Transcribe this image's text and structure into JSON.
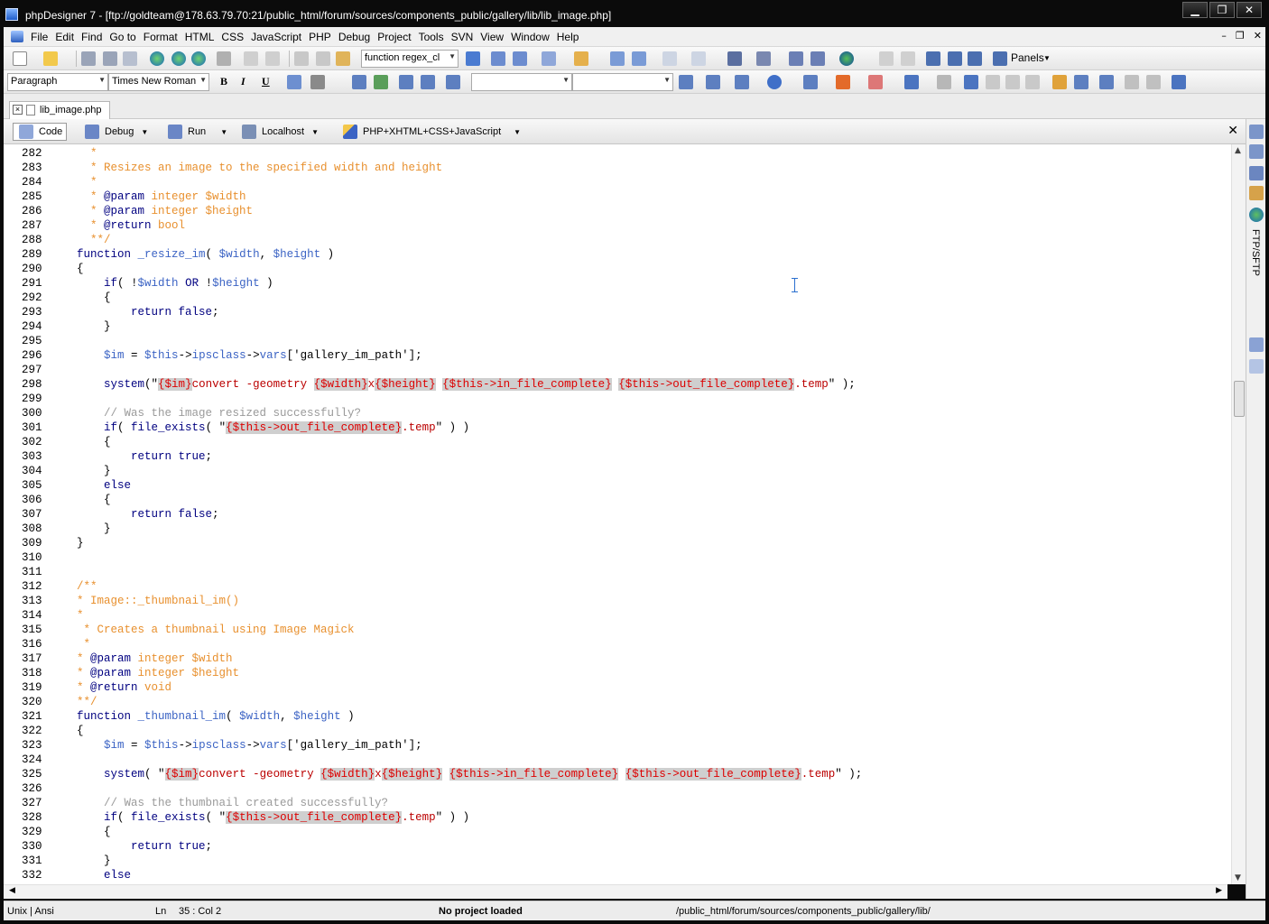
{
  "window": {
    "title": "phpDesigner 7 - [ftp://goldteam@178.63.79.70:21/public_html/forum/sources/components_public/gallery/lib/lib_image.php]",
    "minimize": "▁",
    "maximize": "❐",
    "close": "✕"
  },
  "menu": {
    "items": [
      "File",
      "Edit",
      "Find",
      "Go to",
      "Format",
      "HTML",
      "CSS",
      "JavaScript",
      "PHP",
      "Debug",
      "Project",
      "Tools",
      "SVN",
      "View",
      "Window",
      "Help"
    ],
    "mdi_minimize": "–",
    "mdi_restore": "❐",
    "mdi_close": "✕"
  },
  "toolbar1": {
    "function_combo": "function regex_cl",
    "panels_label": "Panels"
  },
  "toolbar2": {
    "paragraph_combo": "Paragraph",
    "font_combo": "Times New Roman",
    "bold": "B",
    "italic": "I",
    "underline": "U"
  },
  "tabs": {
    "file_tab": "lib_image.php",
    "close": "×"
  },
  "modebar": {
    "code": "Code",
    "debug": "Debug",
    "run": "Run",
    "localhost": "Localhost",
    "language": "PHP+XHTML+CSS+JavaScript",
    "close": "✕"
  },
  "editor": {
    "lines": [
      {
        "n": "282",
        "seg": [
          {
            "c": "t-com",
            "t": "  *"
          }
        ]
      },
      {
        "n": "283",
        "seg": [
          {
            "c": "t-com",
            "t": "  * Resizes an image to the specified width and height"
          }
        ]
      },
      {
        "n": "284",
        "seg": [
          {
            "c": "t-com",
            "t": "  *"
          }
        ]
      },
      {
        "n": "285",
        "seg": [
          {
            "c": "t-com",
            "t": "  * "
          },
          {
            "c": "t-kw",
            "t": "@param"
          },
          {
            "c": "t-com",
            "t": " integer $width"
          }
        ]
      },
      {
        "n": "286",
        "seg": [
          {
            "c": "t-com",
            "t": "  * "
          },
          {
            "c": "t-kw",
            "t": "@param"
          },
          {
            "c": "t-com",
            "t": " integer $height"
          }
        ]
      },
      {
        "n": "287",
        "seg": [
          {
            "c": "t-com",
            "t": "  * "
          },
          {
            "c": "t-kw",
            "t": "@return"
          },
          {
            "c": "t-com",
            "t": " bool"
          }
        ]
      },
      {
        "n": "288",
        "seg": [
          {
            "c": "t-com",
            "t": "  **/"
          }
        ]
      },
      {
        "n": "289",
        "seg": [
          {
            "c": "t-kw",
            "t": "function"
          },
          {
            "c": "t-plain",
            "t": " "
          },
          {
            "c": "t-var",
            "t": "_resize_im"
          },
          {
            "c": "t-plain",
            "t": "( "
          },
          {
            "c": "t-var",
            "t": "$width"
          },
          {
            "c": "t-plain",
            "t": ", "
          },
          {
            "c": "t-var",
            "t": "$height"
          },
          {
            "c": "t-plain",
            "t": " )"
          }
        ]
      },
      {
        "n": "290",
        "seg": [
          {
            "c": "t-plain",
            "t": "{"
          }
        ]
      },
      {
        "n": "291",
        "seg": [
          {
            "c": "t-plain",
            "t": "    "
          },
          {
            "c": "t-kw",
            "t": "if"
          },
          {
            "c": "t-plain",
            "t": "( !"
          },
          {
            "c": "t-var",
            "t": "$width"
          },
          {
            "c": "t-plain",
            "t": " "
          },
          {
            "c": "t-kw",
            "t": "OR"
          },
          {
            "c": "t-plain",
            "t": " !"
          },
          {
            "c": "t-var",
            "t": "$height"
          },
          {
            "c": "t-plain",
            "t": " )"
          }
        ]
      },
      {
        "n": "292",
        "seg": [
          {
            "c": "t-plain",
            "t": "    {"
          }
        ]
      },
      {
        "n": "293",
        "seg": [
          {
            "c": "t-plain",
            "t": "        "
          },
          {
            "c": "t-kw",
            "t": "return false"
          },
          {
            "c": "t-plain",
            "t": ";"
          }
        ]
      },
      {
        "n": "294",
        "seg": [
          {
            "c": "t-plain",
            "t": "    }"
          }
        ]
      },
      {
        "n": "295",
        "seg": []
      },
      {
        "n": "296",
        "seg": [
          {
            "c": "t-plain",
            "t": "    "
          },
          {
            "c": "t-var",
            "t": "$im"
          },
          {
            "c": "t-plain",
            "t": " = "
          },
          {
            "c": "t-var",
            "t": "$this"
          },
          {
            "c": "t-plain",
            "t": "->"
          },
          {
            "c": "t-var",
            "t": "ipsclass"
          },
          {
            "c": "t-plain",
            "t": "->"
          },
          {
            "c": "t-var",
            "t": "vars"
          },
          {
            "c": "t-plain",
            "t": "['gallery_im_path'];"
          }
        ]
      },
      {
        "n": "297",
        "seg": []
      },
      {
        "n": "298",
        "seg": [
          {
            "c": "t-plain",
            "t": "    "
          },
          {
            "c": "t-kw",
            "t": "system"
          },
          {
            "c": "t-plain",
            "t": "(\""
          },
          {
            "c": "t-emb",
            "t": "{$im}"
          },
          {
            "c": "t-str",
            "t": "convert -geometry "
          },
          {
            "c": "t-emb",
            "t": "{$width}"
          },
          {
            "c": "t-str",
            "t": "x"
          },
          {
            "c": "t-emb",
            "t": "{$height}"
          },
          {
            "c": "t-str",
            "t": " "
          },
          {
            "c": "t-emb",
            "t": "{$this->in_file_complete}"
          },
          {
            "c": "t-str",
            "t": " "
          },
          {
            "c": "t-emb",
            "t": "{$this->out_file_complete}"
          },
          {
            "c": "t-str",
            "t": ".temp"
          },
          {
            "c": "t-plain",
            "t": "\" );"
          }
        ]
      },
      {
        "n": "299",
        "seg": []
      },
      {
        "n": "300",
        "seg": [
          {
            "c": "t-grey",
            "t": "    // Was the image resized successfully?"
          }
        ]
      },
      {
        "n": "301",
        "seg": [
          {
            "c": "t-plain",
            "t": "    "
          },
          {
            "c": "t-kw",
            "t": "if"
          },
          {
            "c": "t-plain",
            "t": "( "
          },
          {
            "c": "t-kw",
            "t": "file_exists"
          },
          {
            "c": "t-plain",
            "t": "( \""
          },
          {
            "c": "t-emb",
            "t": "{$this->out_file_complete}"
          },
          {
            "c": "t-str",
            "t": ".temp"
          },
          {
            "c": "t-plain",
            "t": "\" ) )"
          }
        ]
      },
      {
        "n": "302",
        "seg": [
          {
            "c": "t-plain",
            "t": "    {"
          }
        ]
      },
      {
        "n": "303",
        "seg": [
          {
            "c": "t-plain",
            "t": "        "
          },
          {
            "c": "t-kw",
            "t": "return true"
          },
          {
            "c": "t-plain",
            "t": ";"
          }
        ]
      },
      {
        "n": "304",
        "seg": [
          {
            "c": "t-plain",
            "t": "    }"
          }
        ]
      },
      {
        "n": "305",
        "seg": [
          {
            "c": "t-plain",
            "t": "    "
          },
          {
            "c": "t-kw",
            "t": "else"
          }
        ]
      },
      {
        "n": "306",
        "seg": [
          {
            "c": "t-plain",
            "t": "    {"
          }
        ]
      },
      {
        "n": "307",
        "seg": [
          {
            "c": "t-plain",
            "t": "        "
          },
          {
            "c": "t-kw",
            "t": "return false"
          },
          {
            "c": "t-plain",
            "t": ";"
          }
        ]
      },
      {
        "n": "308",
        "seg": [
          {
            "c": "t-plain",
            "t": "    }"
          }
        ]
      },
      {
        "n": "309",
        "seg": [
          {
            "c": "t-plain",
            "t": "}"
          }
        ]
      },
      {
        "n": "310",
        "seg": []
      },
      {
        "n": "311",
        "seg": []
      },
      {
        "n": "312",
        "seg": [
          {
            "c": "t-com",
            "t": "/**"
          }
        ]
      },
      {
        "n": "313",
        "seg": [
          {
            "c": "t-com",
            "t": "* Image::_thumbnail_im()"
          }
        ]
      },
      {
        "n": "314",
        "seg": [
          {
            "c": "t-com",
            "t": "*"
          }
        ]
      },
      {
        "n": "315",
        "seg": [
          {
            "c": "t-com",
            "t": " * Creates a thumbnail using Image Magick"
          }
        ]
      },
      {
        "n": "316",
        "seg": [
          {
            "c": "t-com",
            "t": " *"
          }
        ]
      },
      {
        "n": "317",
        "seg": [
          {
            "c": "t-com",
            "t": "* "
          },
          {
            "c": "t-kw",
            "t": "@param"
          },
          {
            "c": "t-com",
            "t": " integer $width"
          }
        ]
      },
      {
        "n": "318",
        "seg": [
          {
            "c": "t-com",
            "t": "* "
          },
          {
            "c": "t-kw",
            "t": "@param"
          },
          {
            "c": "t-com",
            "t": " integer $height"
          }
        ]
      },
      {
        "n": "319",
        "seg": [
          {
            "c": "t-com",
            "t": "* "
          },
          {
            "c": "t-kw",
            "t": "@return"
          },
          {
            "c": "t-com",
            "t": " void"
          }
        ]
      },
      {
        "n": "320",
        "seg": [
          {
            "c": "t-com",
            "t": "**/"
          }
        ]
      },
      {
        "n": "321",
        "seg": [
          {
            "c": "t-kw",
            "t": "function"
          },
          {
            "c": "t-plain",
            "t": " "
          },
          {
            "c": "t-var",
            "t": "_thumbnail_im"
          },
          {
            "c": "t-plain",
            "t": "( "
          },
          {
            "c": "t-var",
            "t": "$width"
          },
          {
            "c": "t-plain",
            "t": ", "
          },
          {
            "c": "t-var",
            "t": "$height"
          },
          {
            "c": "t-plain",
            "t": " )"
          }
        ]
      },
      {
        "n": "322",
        "seg": [
          {
            "c": "t-plain",
            "t": "{"
          }
        ]
      },
      {
        "n": "323",
        "seg": [
          {
            "c": "t-plain",
            "t": "    "
          },
          {
            "c": "t-var",
            "t": "$im"
          },
          {
            "c": "t-plain",
            "t": " = "
          },
          {
            "c": "t-var",
            "t": "$this"
          },
          {
            "c": "t-plain",
            "t": "->"
          },
          {
            "c": "t-var",
            "t": "ipsclass"
          },
          {
            "c": "t-plain",
            "t": "->"
          },
          {
            "c": "t-var",
            "t": "vars"
          },
          {
            "c": "t-plain",
            "t": "['gallery_im_path'];"
          }
        ]
      },
      {
        "n": "324",
        "seg": []
      },
      {
        "n": "325",
        "seg": [
          {
            "c": "t-plain",
            "t": "    "
          },
          {
            "c": "t-kw",
            "t": "system"
          },
          {
            "c": "t-plain",
            "t": "( \""
          },
          {
            "c": "t-emb",
            "t": "{$im}"
          },
          {
            "c": "t-str",
            "t": "convert -geometry "
          },
          {
            "c": "t-emb",
            "t": "{$width}"
          },
          {
            "c": "t-str",
            "t": "x"
          },
          {
            "c": "t-emb",
            "t": "{$height}"
          },
          {
            "c": "t-str",
            "t": " "
          },
          {
            "c": "t-emb",
            "t": "{$this->in_file_complete}"
          },
          {
            "c": "t-str",
            "t": " "
          },
          {
            "c": "t-emb",
            "t": "{$this->out_file_complete}"
          },
          {
            "c": "t-str",
            "t": ".temp"
          },
          {
            "c": "t-plain",
            "t": "\" );"
          }
        ]
      },
      {
        "n": "326",
        "seg": []
      },
      {
        "n": "327",
        "seg": [
          {
            "c": "t-grey",
            "t": "    // Was the thumbnail created successfully?"
          }
        ]
      },
      {
        "n": "328",
        "seg": [
          {
            "c": "t-plain",
            "t": "    "
          },
          {
            "c": "t-kw",
            "t": "if"
          },
          {
            "c": "t-plain",
            "t": "( "
          },
          {
            "c": "t-kw",
            "t": "file_exists"
          },
          {
            "c": "t-plain",
            "t": "( \""
          },
          {
            "c": "t-emb",
            "t": "{$this->out_file_complete}"
          },
          {
            "c": "t-str",
            "t": ".temp"
          },
          {
            "c": "t-plain",
            "t": "\" ) )"
          }
        ]
      },
      {
        "n": "329",
        "seg": [
          {
            "c": "t-plain",
            "t": "    {"
          }
        ]
      },
      {
        "n": "330",
        "seg": [
          {
            "c": "t-plain",
            "t": "        "
          },
          {
            "c": "t-kw",
            "t": "return true"
          },
          {
            "c": "t-plain",
            "t": ";"
          }
        ]
      },
      {
        "n": "331",
        "seg": [
          {
            "c": "t-plain",
            "t": "    }"
          }
        ]
      },
      {
        "n": "332",
        "seg": [
          {
            "c": "t-plain",
            "t": "    "
          },
          {
            "c": "t-kw",
            "t": "else"
          }
        ]
      }
    ]
  },
  "right_panel": {
    "ftp_label": "FTP/SFTP"
  },
  "statusbar": {
    "encoding": "Unix | Ansi",
    "ln_label": "Ln",
    "position": "35 : Col   2",
    "project": "No project loaded",
    "path": "/public_html/forum/sources/components_public/gallery/lib/"
  },
  "colors": {
    "comment": "#e8902e",
    "keyword": "#000080",
    "variable": "#3b63c4",
    "string": "#bb0000",
    "embedded_var_bg": "#cfcfcf"
  },
  "icons": [
    "app-icon",
    "new-file-icon",
    "open-folder-icon",
    "save-icon",
    "globe-icon",
    "print-icon",
    "undo-icon",
    "redo-icon",
    "cut-icon",
    "copy-icon",
    "paste-icon",
    "bold-icon",
    "italic-icon",
    "underline-icon",
    "table-icon",
    "image-icon",
    "link-icon",
    "ftp-icon",
    "panels-icon"
  ]
}
